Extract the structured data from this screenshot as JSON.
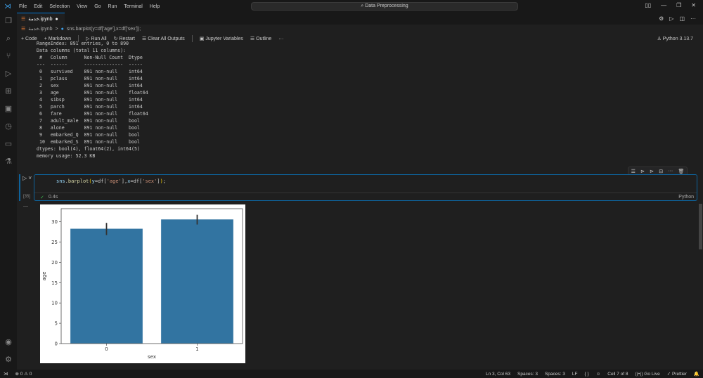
{
  "titlebar": {
    "menu": [
      "File",
      "Edit",
      "Selection",
      "View",
      "Go",
      "Run",
      "Terminal",
      "Help"
    ],
    "search": "Data Preprocessing"
  },
  "tab": {
    "name": "خدمة.ipynb",
    "modified": "●"
  },
  "breadcrumb": {
    "file": "خدمة.ipynb",
    "sep": ">",
    "cell": "sns.barplot(y=df['age'],x=df['sex']);"
  },
  "toolbar": {
    "code": "+ Code",
    "markdown": "+ Markdown",
    "run_all": "Run All",
    "restart": "Restart",
    "clear": "Clear All Outputs",
    "variables": "Jupyter Variables",
    "outline": "Outline",
    "more": "···",
    "kernel": "Python 3.13.7"
  },
  "output_lines": [
    "RangeIndex: 891 entries, 0 to 890",
    "Data columns (total 11 columns):",
    " #   Column      Non-Null Count  Dtype  ",
    "---  ------      --------------  -----  ",
    " 0   survived    891 non-null    int64  ",
    " 1   pclass      891 non-null    int64  ",
    " 2   sex         891 non-null    int64  ",
    " 3   age         891 non-null    float64",
    " 4   sibsp       891 non-null    int64  ",
    " 5   parch       891 non-null    int64  ",
    " 6   fare        891 non-null    float64",
    " 7   adult_male  891 non-null    bool   ",
    " 8   alone       891 non-null    bool   ",
    " 9   embarked_Q  891 non-null    bool   ",
    " 10  embarked_S  891 non-null    bool   ",
    "dtypes: bool(4), float64(2), int64(5)",
    "memory usage: 52.3 KB"
  ],
  "cell": {
    "code": "sns.barplot(y=df['age'],x=df['sex']);",
    "exec_count": "[35]",
    "time": "0.4s",
    "check": "✓",
    "language": "Python"
  },
  "status": {
    "errors": "⊗ 0 ⚠ 0",
    "position": "Ln 3, Col 63",
    "spaces1": "Spaces: 3",
    "spaces2": "Spaces: 3",
    "eol": "LF",
    "braces": "{ }",
    "cell": "Cell 7 of 8",
    "golive": "Go Live",
    "prettier": "✓ Prettier"
  },
  "chart_data": {
    "type": "bar",
    "categories": [
      "0",
      "1"
    ],
    "values": [
      28.3,
      30.6
    ],
    "error_bars": [
      [
        26.7,
        29.7
      ],
      [
        29.3,
        31.7
      ]
    ],
    "xlabel": "sex",
    "ylabel": "age",
    "ylim": [
      0,
      33.2
    ],
    "yticks": [
      0,
      5,
      10,
      15,
      20,
      25,
      30
    ],
    "color": "#3274a1",
    "grid": false
  }
}
